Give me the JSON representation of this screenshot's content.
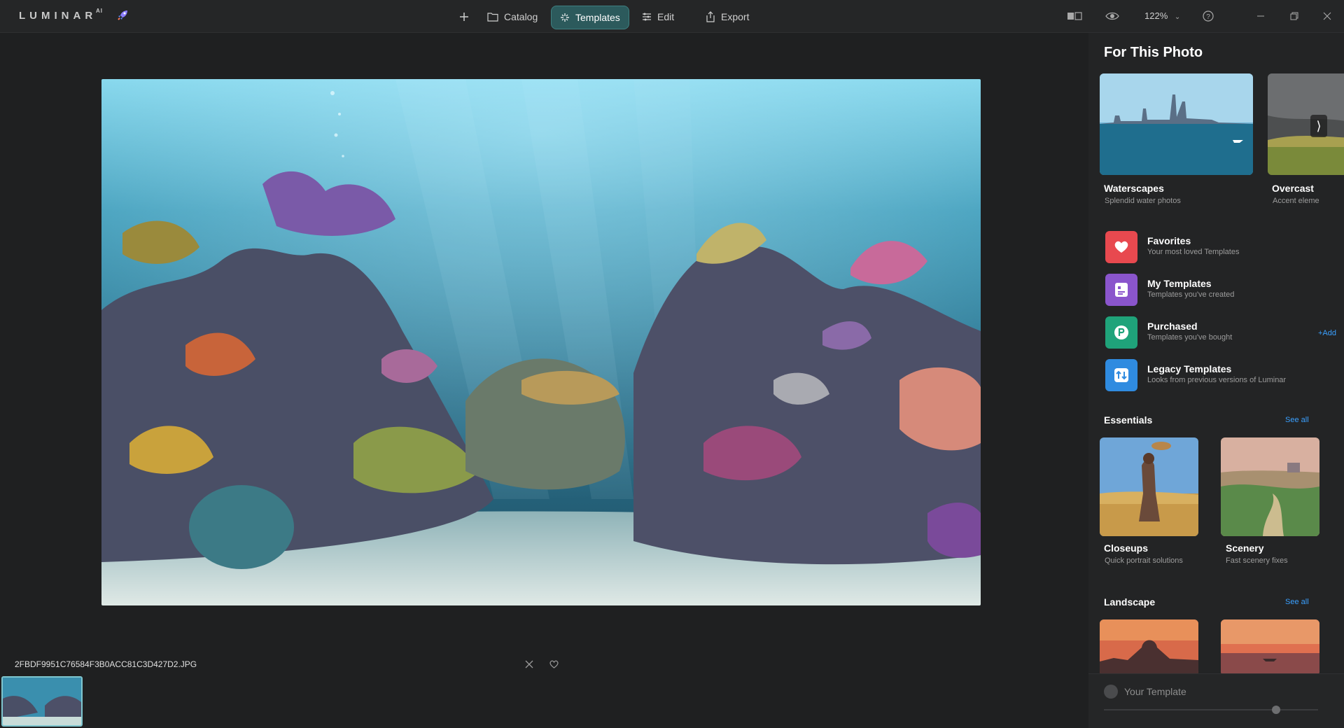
{
  "app": {
    "logo": "LUMINAR",
    "logo_suffix": "AI"
  },
  "toolbar": {
    "catalog": "Catalog",
    "templates": "Templates",
    "edit": "Edit",
    "export": "Export",
    "zoom": "122%"
  },
  "canvas": {
    "filename": "2FBDF9951C76584F3B0ACC81C3D427D2.JPG"
  },
  "panel": {
    "title": "For This Photo",
    "suggestions": [
      {
        "name": "Waterscapes",
        "desc": "Splendid water photos"
      },
      {
        "name": "Overcast",
        "desc": "Accent eleme"
      }
    ],
    "collections": [
      {
        "name": "Favorites",
        "desc": "Your most loved Templates",
        "icon": "heart-icon",
        "color": "#e8494f"
      },
      {
        "name": "My Templates",
        "desc": "Templates you've created",
        "icon": "template-icon",
        "color": "#8a55cc"
      },
      {
        "name": "Purchased",
        "desc": "Templates you've bought",
        "icon": "purchase-icon",
        "color": "#1fa37a",
        "action": "+Add"
      },
      {
        "name": "Legacy Templates",
        "desc": "Looks from previous versions of Luminar",
        "icon": "legacy-icon",
        "color": "#2f8be0"
      }
    ],
    "essentials": {
      "title": "Essentials",
      "see_all": "See all",
      "items": [
        {
          "name": "Closeups",
          "desc": "Quick portrait solutions"
        },
        {
          "name": "Scenery",
          "desc": "Fast scenery fixes"
        }
      ]
    },
    "landscape": {
      "title": "Landscape",
      "see_all": "See all"
    },
    "your_template": "Your Template"
  },
  "colors": {
    "accent": "#2c5a5c",
    "link": "#3aa0ff",
    "background": "#1f2021"
  }
}
